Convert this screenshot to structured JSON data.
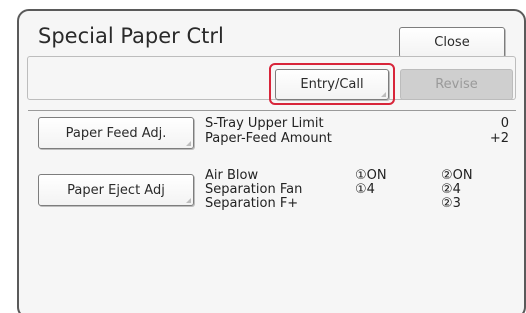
{
  "header": {
    "title": "Special Paper Ctrl",
    "close_label": "Close"
  },
  "toolbar": {
    "entry_call_label": "Entry/Call",
    "revise_label": "Revise"
  },
  "paper_feed": {
    "button_label": "Paper Feed Adj.",
    "rows": [
      {
        "label": "S-Tray Upper Limit",
        "value": "0"
      },
      {
        "label": "Paper-Feed Amount",
        "value": "+2"
      }
    ]
  },
  "paper_eject": {
    "button_label": "Paper Eject Adj",
    "rows": [
      {
        "label": "Air Blow",
        "col1": "①ON",
        "col2": "②ON"
      },
      {
        "label": "Separation Fan",
        "col1": "①4",
        "col2": "②4"
      },
      {
        "label": "Separation F+",
        "col1": "",
        "col2": "②3"
      }
    ]
  },
  "colors": {
    "highlight": "#d8253a",
    "panel_bg": "#f6f6f6",
    "disabled_bg": "#cfcfcf"
  }
}
